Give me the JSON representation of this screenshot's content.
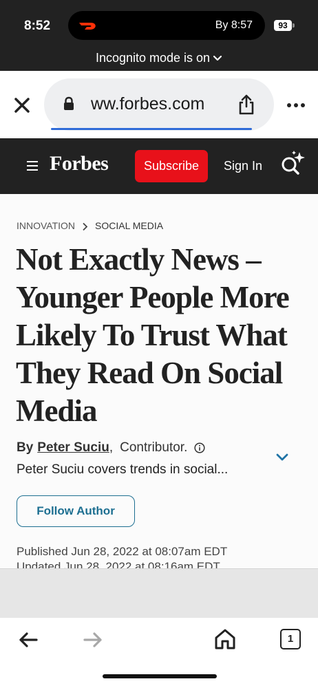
{
  "status_bar": {
    "time": "8:52",
    "activity_text": "By 8:57",
    "activity_app_icon": "doordash-icon",
    "battery_level": "93"
  },
  "incognito_banner": {
    "label": "Incognito mode is on"
  },
  "address_bar": {
    "url": "ww.forbes.com"
  },
  "site_header": {
    "logo": "Forbes",
    "subscribe_label": "Subscribe",
    "signin_label": "Sign In"
  },
  "article": {
    "breadcrumb": [
      "INNOVATION",
      "SOCIAL MEDIA"
    ],
    "headline": "Not Exactly News – Younger People More Likely To Trust What They Read On Social Media",
    "byline_prefix": "By",
    "author_name": "Peter Suciu",
    "author_comma": ",",
    "author_role": "Contributor.",
    "author_description": "Peter Suciu covers trends in social...",
    "follow_label": "Follow Author",
    "published": "Published Jun 28, 2022 at 08:07am EDT",
    "updated": "Updated Jun 28, 2022 at 08:16am EDT"
  },
  "toolbar": {
    "tab_count": "1"
  },
  "colors": {
    "header_bg": "#222222",
    "subscribe_red": "#e8111a",
    "link_blue": "#1d6f91",
    "load_bar_blue": "#2f6bd8",
    "chevron_blue": "#1f73a6"
  }
}
